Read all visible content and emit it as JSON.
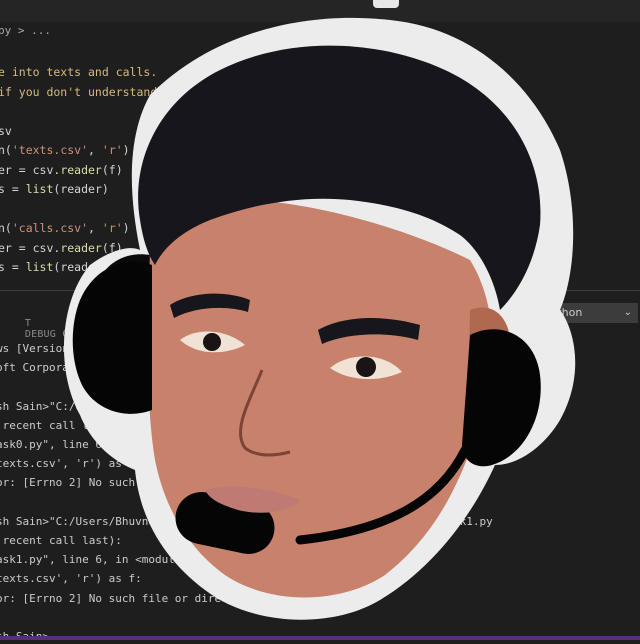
{
  "editor": {
    "breadcrumb": "py > ...",
    "lines": [
      {
        "parts": [
          {
            "t": "e into texts and calls.",
            "c": "cmt"
          }
        ]
      },
      {
        "parts": [
          {
            "t": "if you don't understand how to read",
            "c": "cmt"
          }
        ]
      },
      {
        "parts": []
      },
      {
        "parts": [
          {
            "t": "sv",
            "c": "plain"
          }
        ]
      },
      {
        "parts": [
          {
            "t": "n(",
            "c": "plain"
          },
          {
            "t": "'texts.csv'",
            "c": "str"
          },
          {
            "t": ", ",
            "c": "plain"
          },
          {
            "t": "'r'",
            "c": "str"
          },
          {
            "t": ") ",
            "c": "plain"
          },
          {
            "t": "as",
            "c": "kw"
          },
          {
            "t": " f:",
            "c": "plain"
          }
        ]
      },
      {
        "parts": [
          {
            "t": "er = csv.",
            "c": "plain"
          },
          {
            "t": "reader",
            "c": "fn"
          },
          {
            "t": "(f)",
            "c": "plain"
          }
        ]
      },
      {
        "parts": [
          {
            "t": "s = ",
            "c": "plain"
          },
          {
            "t": "list",
            "c": "fn"
          },
          {
            "t": "(reader)",
            "c": "plain"
          }
        ]
      },
      {
        "parts": []
      },
      {
        "parts": [
          {
            "t": "n(",
            "c": "plain"
          },
          {
            "t": "'calls.csv'",
            "c": "str"
          },
          {
            "t": ", ",
            "c": "plain"
          },
          {
            "t": "'r'",
            "c": "str"
          },
          {
            "t": ") ",
            "c": "plain"
          },
          {
            "t": "as",
            "c": "kw"
          },
          {
            "t": " f:",
            "c": "plain"
          }
        ]
      },
      {
        "parts": [
          {
            "t": "er = csv.",
            "c": "plain"
          },
          {
            "t": "reader",
            "c": "fn"
          },
          {
            "t": "(f)",
            "c": "plain"
          }
        ]
      },
      {
        "parts": [
          {
            "t": "s = ",
            "c": "plain"
          },
          {
            "t": "list",
            "c": "fn"
          },
          {
            "t": "(reader)",
            "c": "plain"
          }
        ]
      }
    ]
  },
  "panel": {
    "tabs": [
      "T",
      "DEBUG CONSOLE"
    ],
    "terminal_select": "1: Python"
  },
  "terminal": {
    "lines": [
      "ws [Version 10",
      "oft Corporatio",
      "",
      "sh Sain>\"C:/Users/",
      " recent call last):",
      "ask0.py\", line 6, in <module>",
      "texts.csv', 'r') as f:",
      "or: [Errno 2] No such file or",
      "",
      "sh Sain>\"C:/Users/Bhuvnesh Sain                                /P0/Task1.py",
      " recent call last):",
      "ask1.py\", line 6, in <module>",
      "texts.csv', 'r') as f:",
      "or: [Errno 2] No such file or director",
      "",
      "sh Sain>"
    ]
  },
  "colors": {
    "editor_bg": "#1e1e1e",
    "skin": "#c8816b",
    "hair": "#18161d",
    "headset": "#050505"
  },
  "icons": {
    "avatar": "cartoon-face-with-headset-icon",
    "dropdown": "chevron-down-icon"
  }
}
